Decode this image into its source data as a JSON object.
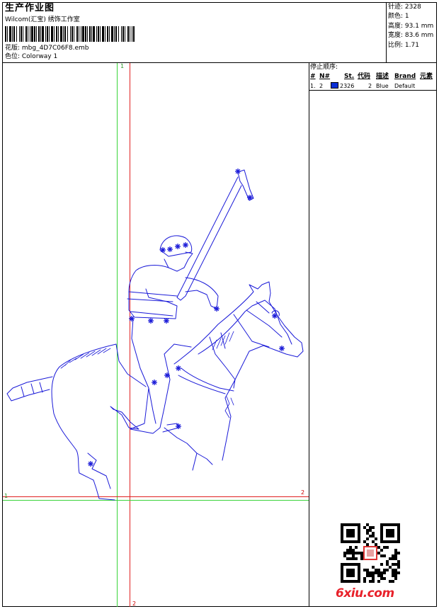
{
  "header": {
    "title": "生产作业图",
    "studio": "Wilcom(汇宝) 绣饰工作室",
    "filename": "花版: mbg_4D7C06F8.emb",
    "colorway": "色位: Colorway 1"
  },
  "specs": {
    "stitches": "针迹: 2328",
    "colors": "颜色: 1",
    "height": "高度: 93.1 mm",
    "width": "宽度: 83.6 mm",
    "scale": "比例: 1.71"
  },
  "stop_sequence": {
    "label": "停止顺序:",
    "headers": [
      "#",
      "N#",
      "St.",
      "代码",
      "描述",
      "Brand",
      "元素"
    ],
    "rows": [
      {
        "num": "1.",
        "n": "2",
        "stitches": "2326",
        "code": "2",
        "desc": "Blue",
        "brand": "Default",
        "element": "",
        "color": "#0a2fd6"
      }
    ]
  },
  "guides": {
    "v_green_label": "1",
    "v_red_label": "2",
    "h_red_label": "2",
    "h_green_label": "1"
  },
  "design": {
    "subject": "polo-player-on-horse",
    "thread_color": "#1a1ad8"
  },
  "watermark": {
    "logo_text": "6xiu.com"
  }
}
